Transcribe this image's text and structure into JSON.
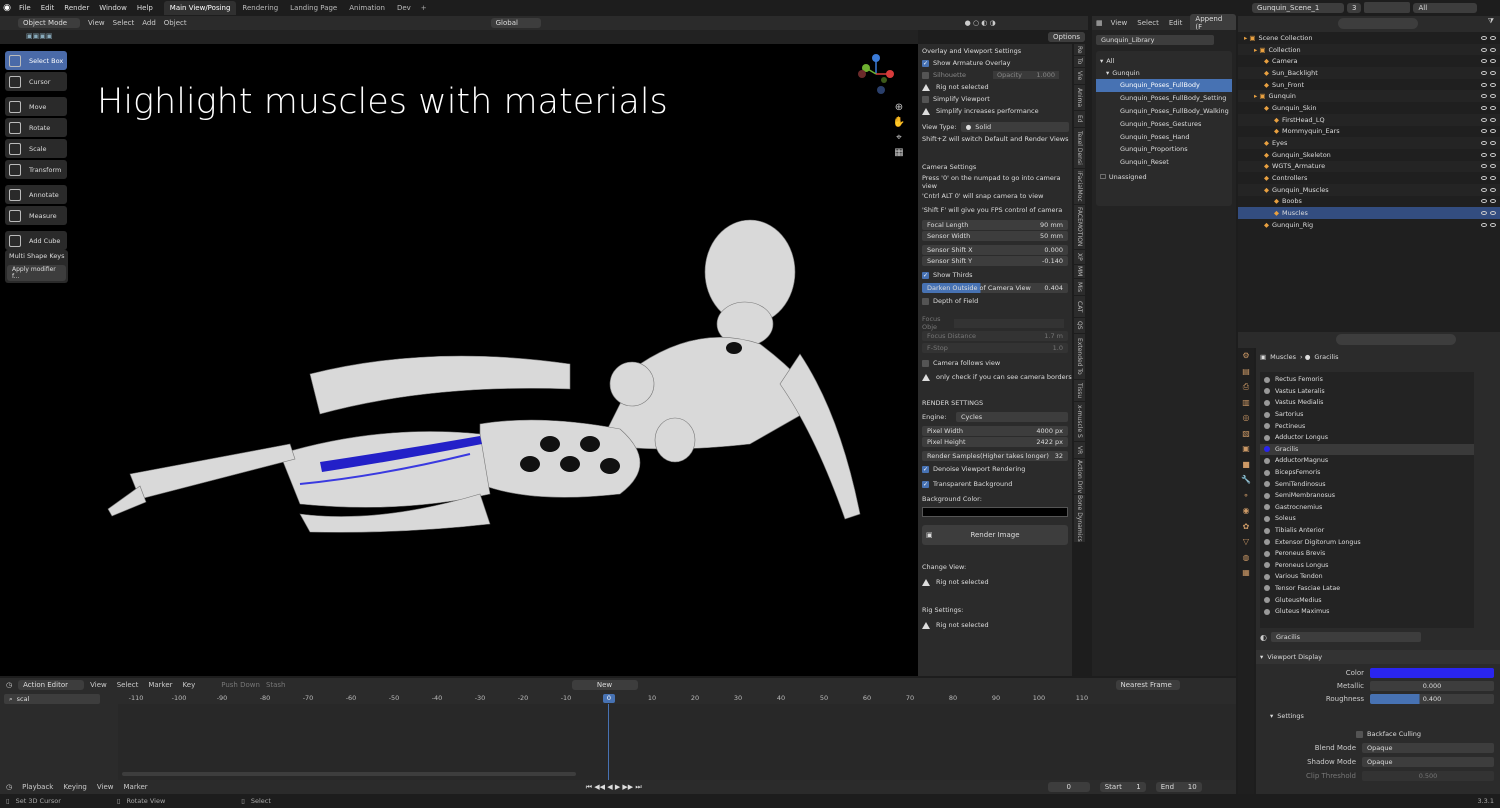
{
  "app": {
    "menus": [
      "File",
      "Edit",
      "Render",
      "Window",
      "Help"
    ],
    "workspaces": [
      "Main View/Posing",
      "Rendering",
      "Landing Page",
      "Animation",
      "Dev"
    ],
    "active_workspace": "Main View/Posing",
    "scene": "Gunquin_Scene_1",
    "scene_count": "3",
    "view_layer": "All"
  },
  "viewport": {
    "mode": "Object Mode",
    "menus": [
      "View",
      "Select",
      "Add",
      "Object"
    ],
    "orientation": "Global",
    "options": "Options",
    "title": "Highlight muscles with materials",
    "tools": [
      "Select Box",
      "Cursor",
      "Move",
      "Rotate",
      "Scale",
      "Transform",
      "Annotate",
      "Measure",
      "Add Cube"
    ],
    "op_panel": {
      "title": "Multi Shape Keys",
      "button": "Apply modifier f..."
    }
  },
  "npanel": {
    "header": "Overlay and Viewport Settings",
    "show_armature": "Show Armature Overlay",
    "silhouette": "Silhouette",
    "opacity_label": "Opacity",
    "opacity": "1.000",
    "rig_not_selected": "Rig not selected",
    "simplify": "Simplify Viewport",
    "simplify_note": "Simplify increases performance",
    "view_type_label": "View Type:",
    "view_type": "Solid",
    "shift_z": "Shift+Z will switch Default and Render Views",
    "camera_header": "Camera Settings",
    "cam_note1": "Press '0' on the numpad to go into camera view",
    "cam_note2": "'Cntrl ALT 0' will snap camera to view",
    "cam_note3": "'Shift F' will give you FPS control of camera",
    "focal_label": "Focal Length",
    "focal": "90 mm",
    "sensor_label": "Sensor Width",
    "sensor": "50 mm",
    "shiftx_label": "Sensor Shift X",
    "shiftx": "0.000",
    "shifty_label": "Sensor Shift Y",
    "shifty": "-0.140",
    "thirds": "Show Thirds",
    "darken_label": "Darken Outside of Camera View",
    "darken": "0.404",
    "dof": "Depth of Field",
    "focus_obj": "Focus Obje",
    "focus_dist_label": "Focus Distance",
    "focus_dist": "1.7 m",
    "fstop_label": "F-Stop",
    "fstop": "1.0",
    "cam_follows": "Camera follows view",
    "cam_border_note": "only check if you can see camera borders",
    "render_header": "RENDER SETTINGS",
    "engine_label": "Engine:",
    "engine": "Cycles",
    "pw_label": "Pixel Width",
    "pw": "4000 px",
    "ph_label": "Pixel Height",
    "ph": "2422 px",
    "samples_label": "Render Samples(Higher takes longer)",
    "samples": "32",
    "denoise": "Denoise Viewport Rendering",
    "transparent": "Transparent Background",
    "bg_color": "Background Color:",
    "render_btn": "Render Image",
    "change_view": "Change View:",
    "rig_settings": "Rig Settings:",
    "tabs": [
      "Re",
      "To",
      "Vie",
      "Anima",
      "Ed",
      "Texel Densi",
      "iFacialMoc",
      "FACEMOTION",
      "XP",
      "MM",
      "Mis",
      "CAT",
      "QS",
      "Extended To",
      "Tissu",
      "x-muscle S",
      "VR",
      "Action Driv",
      "Bone Dynamics"
    ]
  },
  "library": {
    "menus": [
      "View",
      "Select",
      "Edit"
    ],
    "append": "Append (F",
    "name": "Gunquin_Library",
    "all": "All",
    "group": "Gunquin",
    "items": [
      "Gunquin_Poses_FullBody",
      "Gunquin_Poses_FullBody_Setting",
      "Gunquin_Poses_FullBody_Walking",
      "Gunquin_Poses_Gestures",
      "Gunquin_Poses_Hand",
      "Gunquin_Proportions",
      "Gunquin_Reset"
    ],
    "unassigned": "Unassigned"
  },
  "outliner": {
    "items": [
      {
        "label": "Scene Collection",
        "d": 0
      },
      {
        "label": "Collection",
        "d": 1
      },
      {
        "label": "Camera",
        "d": 2
      },
      {
        "label": "Sun_Backlight",
        "d": 2
      },
      {
        "label": "Sun_Front",
        "d": 2
      },
      {
        "label": "Gunquin",
        "d": 1
      },
      {
        "label": "Gunquin_Skin",
        "d": 2
      },
      {
        "label": "FirstHead_LQ",
        "d": 3
      },
      {
        "label": "Mommyquin_Ears",
        "d": 3
      },
      {
        "label": "Eyes",
        "d": 2
      },
      {
        "label": "Gunquin_Skeleton",
        "d": 2
      },
      {
        "label": "WGTS_Armature",
        "d": 2
      },
      {
        "label": "Controllers",
        "d": 2
      },
      {
        "label": "Gunquin_Muscles",
        "d": 2
      },
      {
        "label": "Boobs",
        "d": 3
      },
      {
        "label": "Muscles",
        "d": 3
      },
      {
        "label": "Gunquin_Rig",
        "d": 2
      }
    ],
    "selected": "Muscles"
  },
  "properties": {
    "crumb1": "Muscles",
    "crumb2": "Gracilis",
    "materials": [
      "Rectus Femoris",
      "Vastus Lateralis",
      "Vastus Medialis",
      "Sartorius",
      "Pectineus",
      "Adductor Longus",
      "Gracilis",
      "AdductorMagnus",
      "BicepsFemoris",
      "SemiTendinosus",
      "SemiMembranosus",
      "Gastrocnemius",
      "Soleus",
      "Tibialis Anterior",
      "Extensor Digitorum Longus",
      "Peroneus Brevis",
      "Peroneus Longus",
      "Various Tendon",
      "Tensor Fasciae Latae",
      "GluteusMedius",
      "Gluteus Maximus"
    ],
    "selected": "Gracilis",
    "material_name": "Gracilis",
    "viewport_display": "Viewport Display",
    "color_label": "Color",
    "color": "#2a25f0",
    "metallic_label": "Metallic",
    "metallic": "0.000",
    "rough_label": "Roughness",
    "roughness": "0.400",
    "settings": "Settings",
    "backface": "Backface Culling",
    "blend_label": "Blend Mode",
    "blend": "Opaque",
    "shadow_label": "Shadow Mode",
    "shadow": "Opaque",
    "clip_label": "Clip Threshold",
    "clip": "0.500"
  },
  "timeline": {
    "editor": "Action Editor",
    "menus": [
      "View",
      "Select",
      "Marker",
      "Key"
    ],
    "push": "Push Down",
    "stash": "Stash",
    "new": "New",
    "search": "scal",
    "snap": "Nearest Frame",
    "ticks": [
      "-110",
      "-100",
      "-90",
      "-80",
      "-70",
      "-60",
      "-50",
      "-40",
      "-30",
      "-20",
      "-10",
      "0",
      "10",
      "20",
      "30",
      "40",
      "50",
      "60",
      "70",
      "80",
      "90",
      "100",
      "110"
    ],
    "current": "0",
    "playback": "Playback",
    "keying": "Keying",
    "view": "View",
    "marker": "Marker",
    "frame": "0",
    "start_label": "Start",
    "start": "1",
    "end_label": "End",
    "end": "10"
  },
  "status": {
    "s1": "Set 3D Cursor",
    "s2": "Rotate View",
    "s3": "Select",
    "version": "3.3.1"
  }
}
